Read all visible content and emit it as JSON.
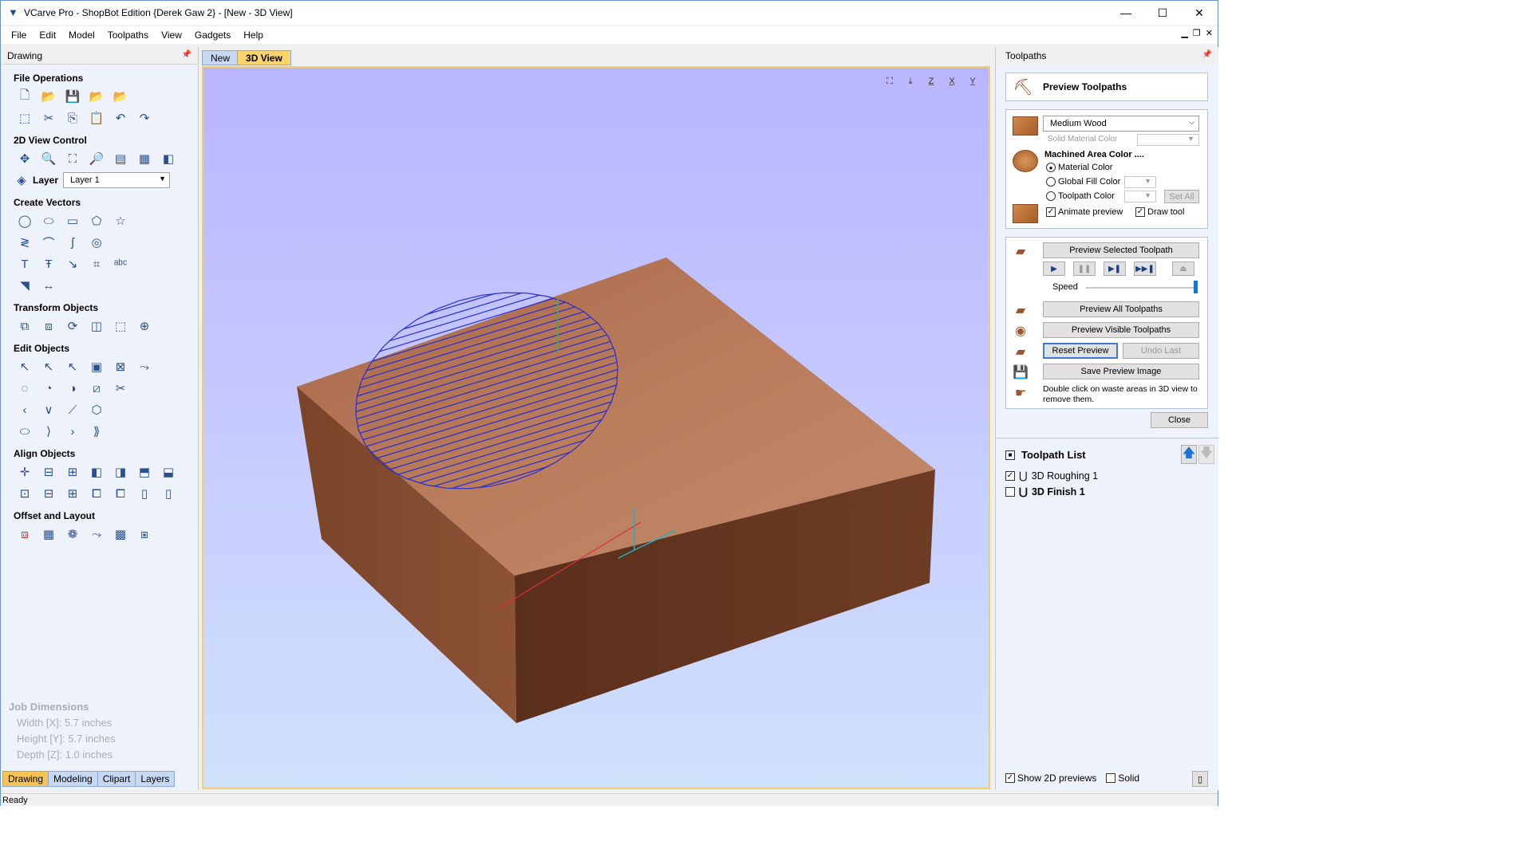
{
  "window": {
    "title": "VCarve Pro - ShopBot Edition {Derek Gaw 2} - [New - 3D View]",
    "minimize": "—",
    "maximize": "☐",
    "close": "✕"
  },
  "menu": [
    "File",
    "Edit",
    "Model",
    "Toolpaths",
    "View",
    "Gadgets",
    "Help"
  ],
  "left_panel": {
    "title": "Drawing",
    "sections": {
      "file_operations": "File Operations",
      "view_control": "2D View Control",
      "create_vectors": "Create Vectors",
      "transform_objects": "Transform Objects",
      "edit_objects": "Edit Objects",
      "align_objects": "Align Objects",
      "offset_layout": "Offset and Layout"
    },
    "layer_label": "Layer",
    "layer_value": "Layer 1",
    "job_dimensions": {
      "title": "Job Dimensions",
      "width": "Width  [X]: 5.7 inches",
      "height": "Height [Y]: 5.7 inches",
      "depth": "Depth  [Z]: 1.0 inches"
    },
    "tabs": [
      "Drawing",
      "Modeling",
      "Clipart",
      "Layers"
    ]
  },
  "doc_tabs": [
    "New",
    "3D View"
  ],
  "right_panel": {
    "title": "Toolpaths",
    "preview_title": "Preview Toolpaths",
    "material": "Medium Wood",
    "solid_material_color": "Solid Material Color",
    "machined_area_color": "Machined Area Color ....",
    "radio_material": "Material Color",
    "radio_global": "Global Fill Color",
    "radio_toolpath": "Toolpath Color",
    "set_all": "Set All",
    "animate_preview": "Animate preview",
    "draw_tool": "Draw tool",
    "preview_selected": "Preview Selected Toolpath",
    "speed": "Speed",
    "preview_all": "Preview All Toolpaths",
    "preview_visible": "Preview Visible Toolpaths",
    "reset_preview": "Reset Preview",
    "undo_last": "Undo Last",
    "save_preview": "Save Preview Image",
    "hint": "Double click on waste areas in 3D view to remove them.",
    "close": "Close",
    "toolpath_list_title": "Toolpath List",
    "toolpaths": [
      {
        "name": "3D Roughing 1",
        "checked": true
      },
      {
        "name": "3D Finish 1",
        "checked": false
      }
    ],
    "show_2d_previews": "Show 2D previews",
    "solid": "Solid"
  },
  "status": "Ready",
  "colors": {
    "wood_top": "#b87a58",
    "wood_left": "#8a4f33",
    "wood_front": "#6b3a23",
    "toolpath": "#2a2cd0",
    "accent_tab": "#fbd36b"
  }
}
